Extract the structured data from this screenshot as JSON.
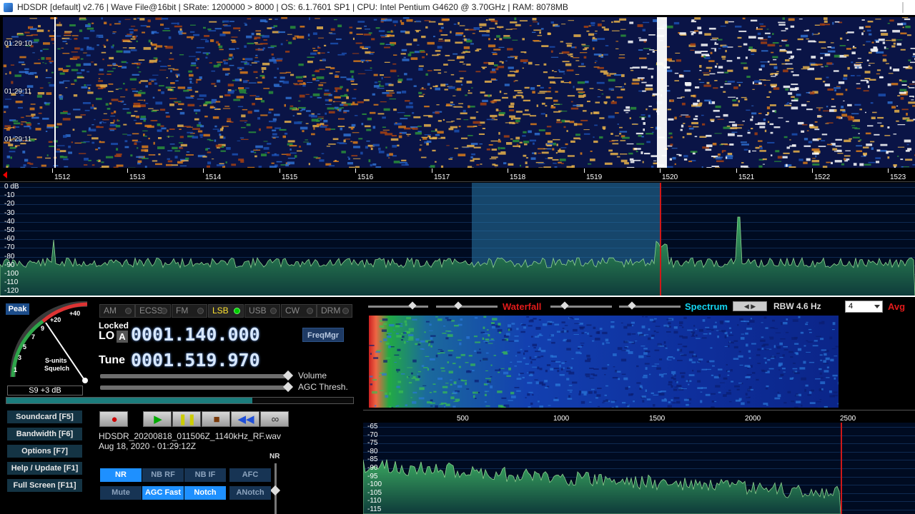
{
  "window": {
    "title": "HDSDR  [default]  v2.76   |  Wave File@16bit  |  SRate: 1200000 > 8000  |  OS: 6.1.7601 SP1  |  CPU: Intel Pentium G4620 @ 3.70GHz  |  RAM: 8078MB"
  },
  "waterfall_top": {
    "timestamps": [
      "01:29:10",
      "01:29:11",
      "01:29:11"
    ]
  },
  "freq_scale_top": {
    "ticks": [
      "1512",
      "1513",
      "1514",
      "1515",
      "1516",
      "1517",
      "1518",
      "1519",
      "1520",
      "1521",
      "1522",
      "1523"
    ]
  },
  "spectrum_top": {
    "db_labels": [
      "0 dB",
      "-10",
      "-20",
      "-30",
      "-40",
      "-50",
      "-60",
      "-70",
      "-80",
      "-90",
      "-100",
      "-110",
      "-120"
    ]
  },
  "meter": {
    "peak_label": "Peak",
    "scale_labels": [
      "+40",
      "+20",
      "9",
      "7",
      "5",
      "3",
      "1"
    ],
    "title_line1": "S-units",
    "title_line2": "Squelch",
    "value": "S9 +3 dB"
  },
  "modes": {
    "items": [
      "AM",
      "ECSS",
      "FM",
      "LSB",
      "USB",
      "CW",
      "DRM"
    ],
    "active": "LSB"
  },
  "lo": {
    "locked_label": "Locked",
    "label": "LO",
    "channel": "A",
    "freq": "0001.140.000"
  },
  "tune": {
    "label": "Tune",
    "freq": "0001.519.970"
  },
  "freqmgr_label": "FreqMgr",
  "sliders": {
    "volume": "Volume",
    "agc": "AGC Thresh."
  },
  "playback_progress": 0.71,
  "side_buttons": [
    "Soundcard  [F5]",
    "Bandwidth  [F6]",
    "Options    [F7]",
    "Help / Update  [F1]",
    "Full Screen  [F11]"
  ],
  "file": {
    "name": "HDSDR_20200818_011506Z_1140kHz_RF.wav",
    "datetime": "Aug 18, 2020 - 01:29:12Z"
  },
  "nr_label": "NR",
  "filter_buttons": [
    {
      "label": "NR",
      "on": true
    },
    {
      "label": "NB RF",
      "on": false
    },
    {
      "label": "NB IF",
      "on": false
    },
    {
      "label": "AFC",
      "on": false
    },
    {
      "label": "Mute",
      "on": false
    },
    {
      "label": "AGC Fast",
      "on": true
    },
    {
      "label": "Notch",
      "on": true
    },
    {
      "label": "ANotch",
      "on": false
    }
  ],
  "audio": {
    "waterfall_label": "Waterfall",
    "spectrum_label": "Spectrum",
    "rbw_label": "RBW  4.6 Hz",
    "avg_value": "4",
    "avg_label": "Avg",
    "freq_ticks": [
      "500",
      "1000",
      "1500",
      "2000",
      "2500"
    ],
    "db_labels": [
      "-65",
      "-70",
      "-75",
      "-80",
      "-85",
      "-90",
      "-95",
      "-100",
      "-105",
      "-110",
      "-115"
    ]
  },
  "colors": {
    "lsb_active": "#ffe22e",
    "waterfall_label": "#e21b1b",
    "spectrum_label": "#14d4f0",
    "toggle_on": "#1e90ff",
    "toggle_off": "#173454"
  }
}
